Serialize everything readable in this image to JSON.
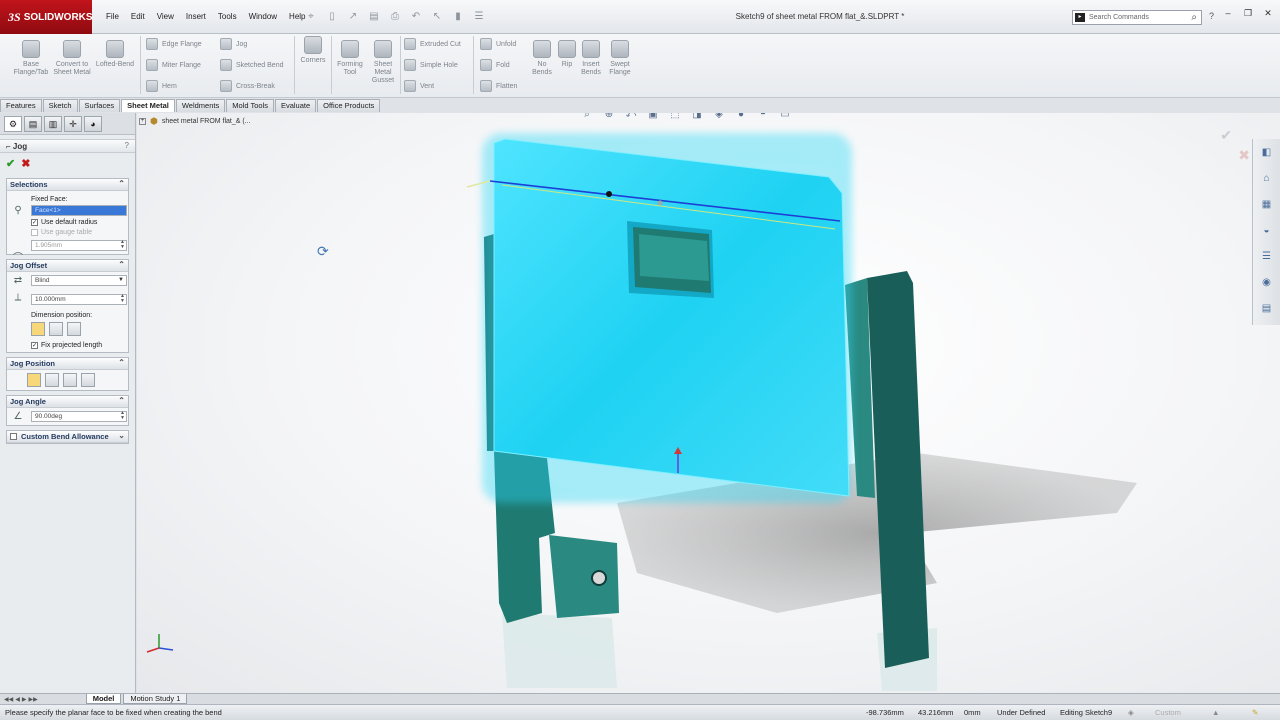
{
  "app": {
    "logo_text": "SOLIDWORKS",
    "logo_mark": "3S",
    "document_title": "Sketch9 of sheet metal FROM flat_&.SLDPRT *"
  },
  "menu": [
    "File",
    "Edit",
    "View",
    "Insert",
    "Tools",
    "Window",
    "Help"
  ],
  "search": {
    "placeholder": "Search Commands"
  },
  "ribbon": {
    "base_flange": "Base Flange/Tab",
    "convert": "Convert to Sheet Metal",
    "lofted_bend": "Lofted-Bend",
    "edge_flange": "Edge Flange",
    "miter_flange": "Miter Flange",
    "hem": "Hem",
    "jog": "Jog",
    "sketched_bend": "Sketched Bend",
    "cross_break": "Cross-Break",
    "corners": "Corners",
    "forming_tool": "Forming Tool",
    "gusset": "Sheet Metal Gusset",
    "extruded_cut": "Extruded Cut",
    "simple_hole": "Simple Hole",
    "vent": "Vent",
    "unfold": "Unfold",
    "fold": "Fold",
    "flatten": "Flatten",
    "no_bends": "No Bends",
    "rip": "Rip",
    "insert_bends": "Insert Bends",
    "swept_flange": "Swept Flange"
  },
  "command_tabs": [
    "Features",
    "Sketch",
    "Surfaces",
    "Sheet Metal",
    "Weldments",
    "Mold Tools",
    "Evaluate",
    "Office Products"
  ],
  "active_command_tab": "Sheet Metal",
  "property_manager": {
    "title": "Jog",
    "selections": {
      "header": "Selections",
      "fixed_face_label": "Fixed Face:",
      "fixed_face_value": "Face<1>",
      "use_default_radius": "Use default radius",
      "use_gauge_table": "Use gauge table",
      "radius_value": "1.905mm"
    },
    "jog_offset": {
      "header": "Jog Offset",
      "end_condition": "Blind",
      "distance": "10.000mm",
      "dimension_position_label": "Dimension position:",
      "fix_projected_length": "Fix projected length"
    },
    "jog_position": {
      "header": "Jog Position"
    },
    "jog_angle": {
      "header": "Jog Angle",
      "value": "90.00deg"
    },
    "custom_bend": {
      "header": "Custom Bend Allowance"
    }
  },
  "tree": {
    "label": "sheet metal FROM flat_&  (..."
  },
  "bottom_tabs": [
    "Model",
    "Motion Study 1"
  ],
  "status": {
    "message": "Please specify the planar face to be fixed when creating the bend",
    "x": "-98.736mm",
    "y": "43.216mm",
    "z": "0mm",
    "state": "Under Defined",
    "editing": "Editing Sketch9",
    "units": "Custom"
  },
  "colors": {
    "model_face": "#29d4f0",
    "model_body": "#1f6b66",
    "brand_red": "#c2141c"
  }
}
